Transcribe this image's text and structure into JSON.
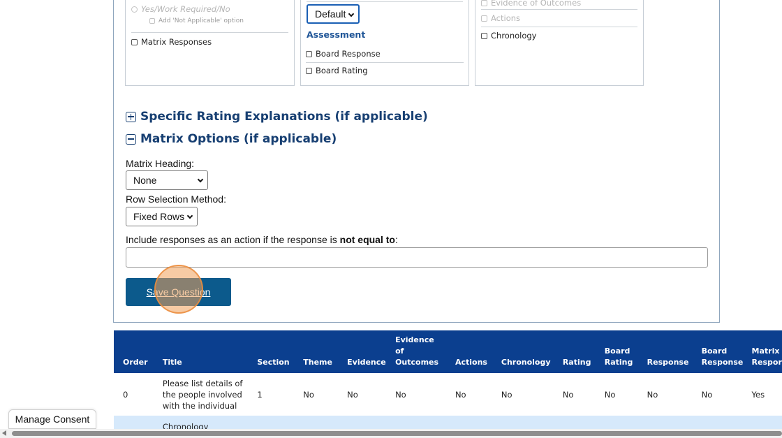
{
  "columns": {
    "col1": {
      "radio_label": "Yes/Work Required/No",
      "na_option_label": "Add 'Not Applicable' option",
      "matrix_responses_label": "Matrix Responses"
    },
    "col2": {
      "select_value": "Default",
      "assessment_heading": "Assessment",
      "board_response_label": "Board Response",
      "board_rating_label": "Board Rating"
    },
    "col3": {
      "evidence_of_outcomes_label": "Evidence of Outcomes",
      "actions_label": "Actions",
      "chronology_label": "Chronology"
    }
  },
  "sections": {
    "specific_rating": "Specific Rating Explanations (if applicable)",
    "matrix_options": "Matrix Options (if applicable)"
  },
  "matrix": {
    "heading_label": "Matrix Heading:",
    "heading_value": "None",
    "row_selection_label": "Row Selection Method:",
    "row_selection_value": "Fixed Rows",
    "include_label_prefix": "Include responses as an action if the response is ",
    "include_label_bold": "not equal to",
    "include_label_suffix": ":",
    "include_value": ""
  },
  "save_button_label": "Save Question",
  "table": {
    "headers": [
      {
        "lines": [
          "Order"
        ]
      },
      {
        "lines": [
          "Title"
        ]
      },
      {
        "lines": [
          "Section"
        ]
      },
      {
        "lines": [
          "Theme"
        ]
      },
      {
        "lines": [
          "Evidence"
        ]
      },
      {
        "lines": [
          "Evidence",
          "of",
          "Outcomes"
        ]
      },
      {
        "lines": [
          "Actions"
        ]
      },
      {
        "lines": [
          "Chronology"
        ]
      },
      {
        "lines": [
          "Rating"
        ]
      },
      {
        "lines": [
          "Board",
          "Rating"
        ]
      },
      {
        "lines": [
          "Response"
        ]
      },
      {
        "lines": [
          "Board",
          "Response"
        ]
      },
      {
        "lines": [
          "Matrix",
          "Respor"
        ]
      }
    ],
    "rows": [
      {
        "order": "0",
        "title_lines": [
          "Please list details of",
          "the people involved",
          "with the individual"
        ],
        "section": "1",
        "theme": "No",
        "evidence": "No",
        "evidence_of_outcomes": "No",
        "actions": "No",
        "chronology": "No",
        "rating": "No",
        "board_rating": "No",
        "response": "No",
        "board_response": "No",
        "matrix_responses": "Yes"
      },
      {
        "order": "",
        "title_lines": [
          "Chronology"
        ]
      }
    ]
  },
  "consent_label": "Manage Consent"
}
